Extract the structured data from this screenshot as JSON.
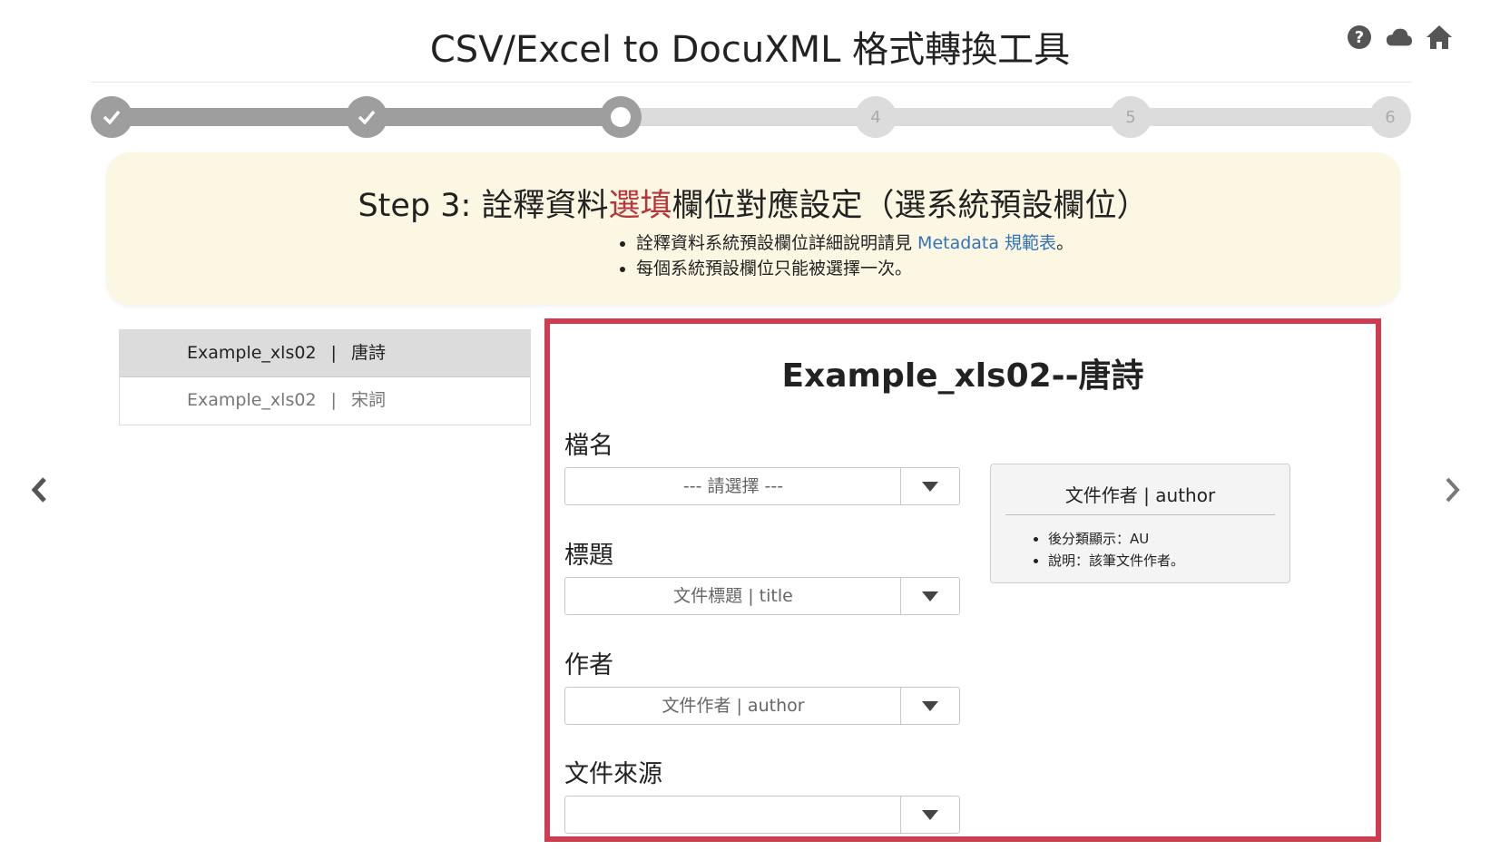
{
  "header": {
    "title": "CSV/Excel to DocuXML 格式轉換工具",
    "icons": [
      "help-icon",
      "cloud-icon",
      "home-icon"
    ]
  },
  "stepper": {
    "steps": [
      {
        "label": "",
        "state": "done"
      },
      {
        "label": "",
        "state": "done"
      },
      {
        "label": "",
        "state": "current"
      },
      {
        "label": "4",
        "state": "todo"
      },
      {
        "label": "5",
        "state": "todo"
      },
      {
        "label": "6",
        "state": "todo"
      }
    ]
  },
  "banner": {
    "title_prefix": "Step 3: 詮釋資料",
    "title_highlight": "選填",
    "title_suffix": "欄位對應設定（選系統預設欄位）",
    "bullet1_text": "詮釋資料系統預設欄位詳細說明請見 ",
    "bullet1_link": "Metadata 規範表",
    "bullet1_end": "。",
    "bullet2": "每個系統預設欄位只能被選擇一次。"
  },
  "file_list": [
    {
      "file": "Example_xls02",
      "sep": "|",
      "sheet": "唐詩",
      "active": true
    },
    {
      "file": "Example_xls02",
      "sep": "|",
      "sheet": "宋詞",
      "active": false
    }
  ],
  "panel": {
    "title": "Example_xls02--唐詩",
    "fields": [
      {
        "label": "檔名",
        "value": "--- 請選擇 ---"
      },
      {
        "label": "標題",
        "value": "文件標題 | title"
      },
      {
        "label": "作者",
        "value": "文件作者 | author"
      },
      {
        "label": "文件來源",
        "value": ""
      }
    ],
    "info": {
      "head": "文件作者 | author",
      "line1": "後分類顯示：AU",
      "line2": "說明：該筆文件作者。"
    }
  },
  "colors": {
    "highlight": "#b5353b",
    "link": "#3273b8",
    "panel_border": "#cf3c4f",
    "banner_bg": "#fcf7e3"
  }
}
